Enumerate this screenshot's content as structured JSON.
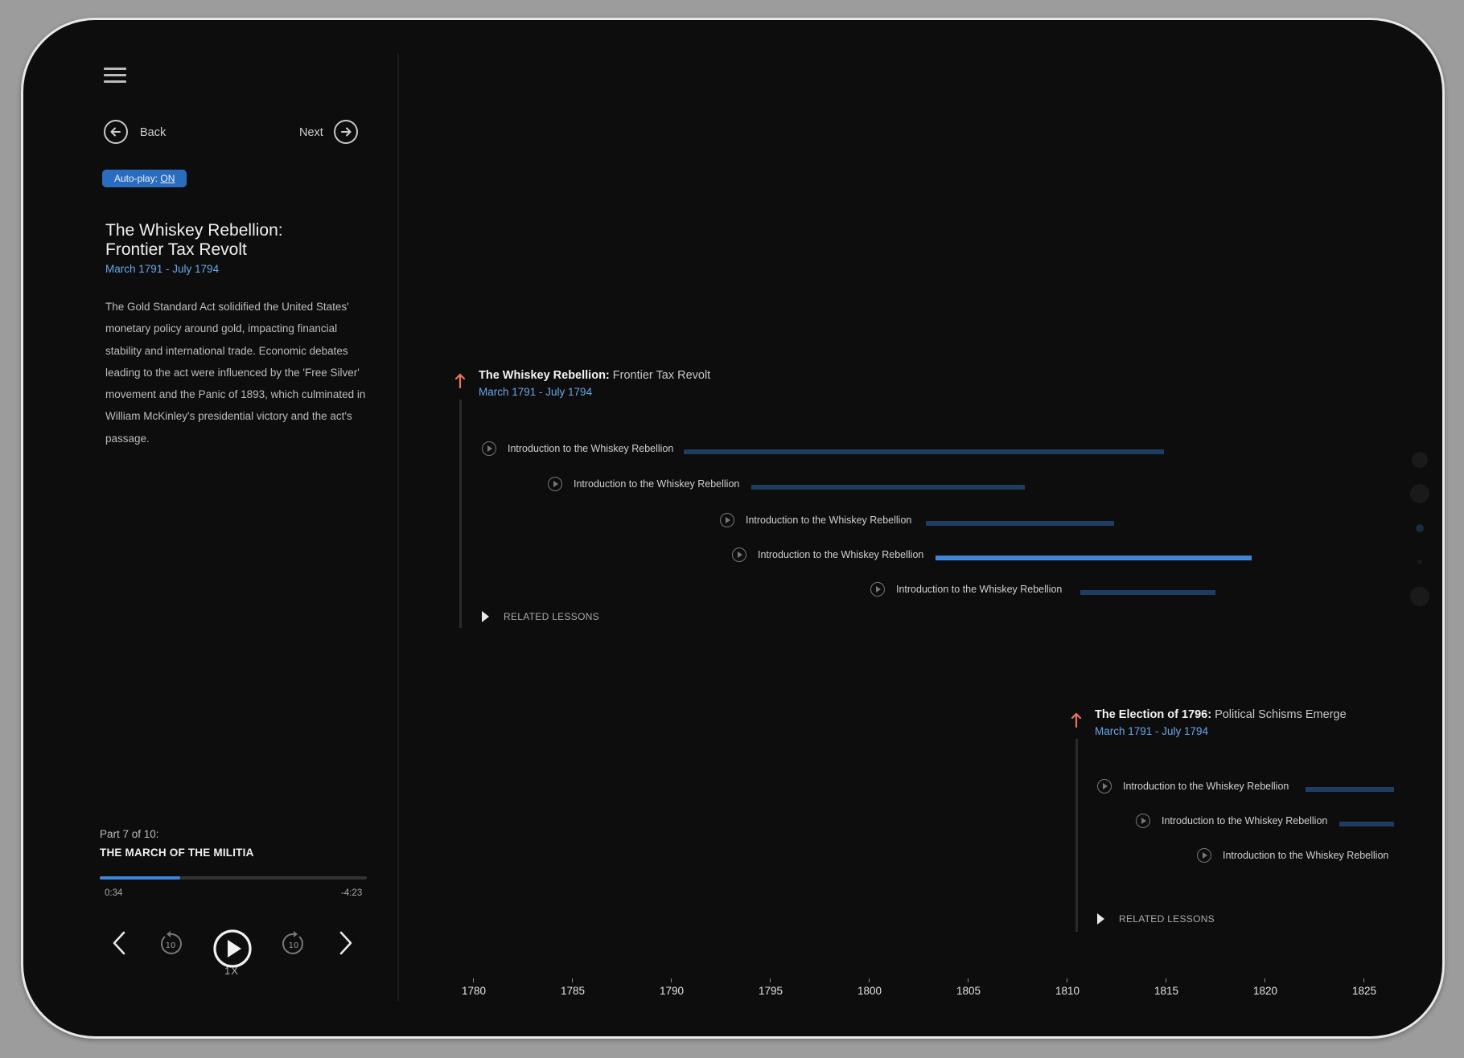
{
  "sidebar": {
    "back_label": "Back",
    "next_label": "Next",
    "autoplay_prefix": "Auto-play: ",
    "autoplay_state": "ON",
    "title_line1": "The Whiskey Rebellion:",
    "title_line2": "Frontier Tax Revolt",
    "date": "March 1791 - July 1794",
    "description": "The Gold Standard Act solidified the United States' monetary policy around gold, impacting financial stability and international trade. Economic debates leading to the act were influenced by the 'Free Silver' movement and the Panic of 1893, which culminated in William McKinley's presidential victory and the act's passage."
  },
  "player": {
    "part_label": "Part 7 of 10:",
    "part_title": "THE MARCH OF THE MILITIA",
    "progress": 0.3,
    "elapsed": "0:34",
    "remaining": "-4:23",
    "speed": "1X",
    "skip_seconds": "10"
  },
  "timeline": {
    "events": [
      {
        "title_bold": "The Whiskey Rebellion:",
        "title_rest": " Frontier Tax Revolt",
        "date": "March 1791 - July 1794",
        "lessons": [
          {
            "label": "Introduction to the Whiskey Rebellion",
            "active": false
          },
          {
            "label": "Introduction to the Whiskey Rebellion",
            "active": false
          },
          {
            "label": "Introduction to the Whiskey Rebellion",
            "active": false
          },
          {
            "label": "Introduction to the Whiskey Rebellion",
            "active": true
          },
          {
            "label": "Introduction to the Whiskey Rebellion",
            "active": false
          }
        ],
        "related_label": "RELATED LESSONS"
      },
      {
        "title_bold": "The Election of 1796:",
        "title_rest": " Political Schisms Emerge",
        "date": "March 1791 - July 1794",
        "lessons": [
          {
            "label": "Introduction to the Whiskey Rebellion",
            "active": false
          },
          {
            "label": "Introduction to the Whiskey Rebellion",
            "active": false
          },
          {
            "label": "Introduction to the Whiskey Rebellion",
            "active": false
          }
        ],
        "related_label": "RELATED LESSONS"
      }
    ],
    "axis_ticks": [
      "1780",
      "1785",
      "1790",
      "1795",
      "1800",
      "1805",
      "1810",
      "1815",
      "1820",
      "1825"
    ]
  },
  "colors": {
    "accent": "#3d86da",
    "bar_inactive": "#1e3d62",
    "event_marker": "#e8755a",
    "date_text": "#69a7e8"
  }
}
